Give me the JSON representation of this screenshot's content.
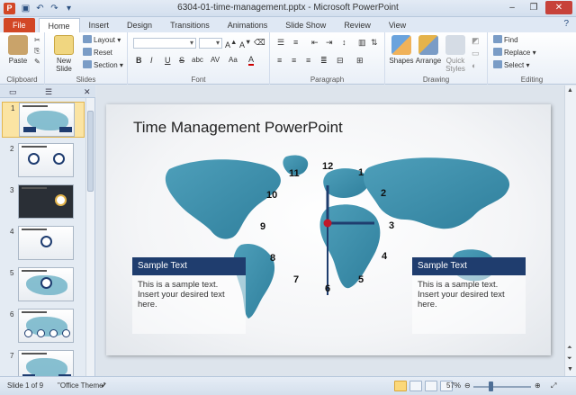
{
  "window": {
    "title": "6304-01-time-management.pptx - Microsoft PowerPoint",
    "app_letter": "P"
  },
  "tabs": [
    "File",
    "Home",
    "Insert",
    "Design",
    "Transitions",
    "Animations",
    "Slide Show",
    "Review",
    "View"
  ],
  "ribbon": {
    "clipboard": {
      "label": "Clipboard",
      "paste": "Paste"
    },
    "slides": {
      "label": "Slides",
      "new_slide": "New Slide",
      "layout": "Layout",
      "reset": "Reset",
      "section": "Section"
    },
    "font": {
      "label": "Font",
      "bold": "B",
      "italic": "I",
      "underline": "U",
      "strike": "S",
      "shadow": "abc",
      "spacing": "AV",
      "case": "Aa",
      "color": "A"
    },
    "paragraph": {
      "label": "Paragraph"
    },
    "drawing": {
      "label": "Drawing",
      "shapes": "Shapes",
      "arrange": "Arrange",
      "quick_styles": "Quick Styles"
    },
    "editing": {
      "label": "Editing",
      "find": "Find",
      "replace": "Replace",
      "select": "Select"
    }
  },
  "slide_panel": {
    "thumbnails": [
      {
        "num": "1",
        "selected": true,
        "kind": "map"
      },
      {
        "num": "2",
        "selected": false,
        "kind": "clocks"
      },
      {
        "num": "3",
        "selected": false,
        "kind": "dark"
      },
      {
        "num": "4",
        "selected": false,
        "kind": "clock-one"
      },
      {
        "num": "5",
        "selected": false,
        "kind": "map-clock"
      },
      {
        "num": "6",
        "selected": false,
        "kind": "map-row"
      },
      {
        "num": "7",
        "selected": false,
        "kind": "map"
      }
    ]
  },
  "slide": {
    "title": "Time Management PowerPoint",
    "clock_numbers": [
      "12",
      "1",
      "2",
      "3",
      "4",
      "5",
      "6",
      "7",
      "8",
      "9",
      "10",
      "11"
    ],
    "left_box": {
      "header": "Sample Text",
      "body": "This is a sample text. Insert your desired text here."
    },
    "right_box": {
      "header": "Sample Text",
      "body": "This is a sample text. Insert your desired text here."
    }
  },
  "status": {
    "slide_of": "Slide 1 of 9",
    "theme": "\"Office Theme\"",
    "zoom": "57%"
  },
  "colors": {
    "file_tab": "#d24726",
    "header_navy": "#1f3d6e",
    "map_teal": "#5aa8c0",
    "clock_red": "#c0182a"
  }
}
